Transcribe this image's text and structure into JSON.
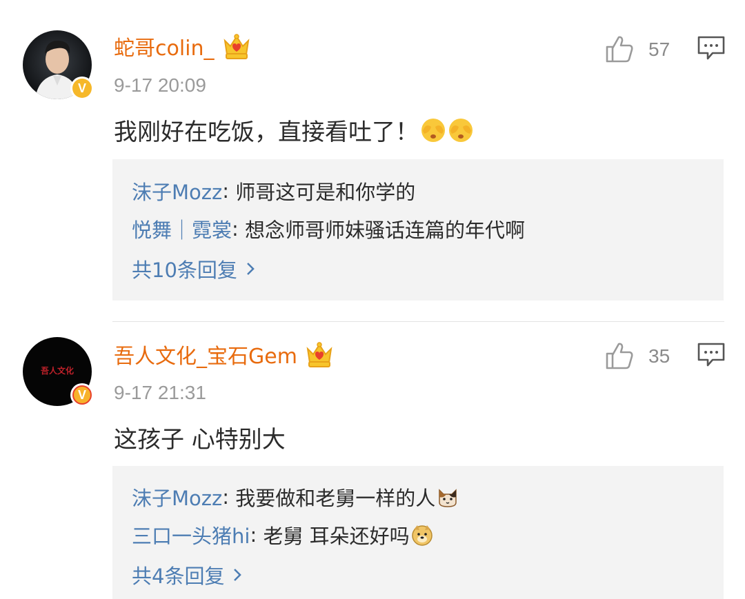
{
  "comments": [
    {
      "username": "蛇哥colin_",
      "timestamp": "9-17 20:09",
      "text": "我刚好在吃饭，直接看吐了！",
      "emojis": [
        "cover-face-emoji",
        "cover-face-emoji"
      ],
      "likes": "57",
      "avatar": "man-portrait",
      "badge": "crown-badge",
      "verified": "yellow-v",
      "replies": [
        {
          "user": "沫子Mozz",
          "sep": ": ",
          "text": "师哥这可是和你学的"
        },
        {
          "user": "悦舞｜霓裳",
          "sep": ": ",
          "text": "想念师哥师妹骚话连篇的年代啊"
        }
      ],
      "more_replies": "共10条回复"
    },
    {
      "username": "吾人文化_宝石Gem",
      "timestamp": "9-17 21:31",
      "text": "这孩子 心特别大",
      "likes": "35",
      "avatar": "black-logo",
      "avatar_logo_text": "吾人文化",
      "badge": "crown-badge",
      "verified": "orange-v",
      "replies": [
        {
          "user": "沫子Mozz",
          "sep": ": ",
          "text": "我要做和老舅一样的人",
          "emoji": "cat-emoji"
        },
        {
          "user": "三口一头猪hi",
          "sep": ": ",
          "text": "老舅 耳朵还好吗",
          "emoji": "doge-emoji"
        }
      ],
      "more_replies": "共4条回复"
    }
  ],
  "colors": {
    "username": "#e86b0e",
    "reply_user": "#4d7db3",
    "timestamp": "#9a9a9a",
    "reply_bg": "#f3f3f3"
  }
}
